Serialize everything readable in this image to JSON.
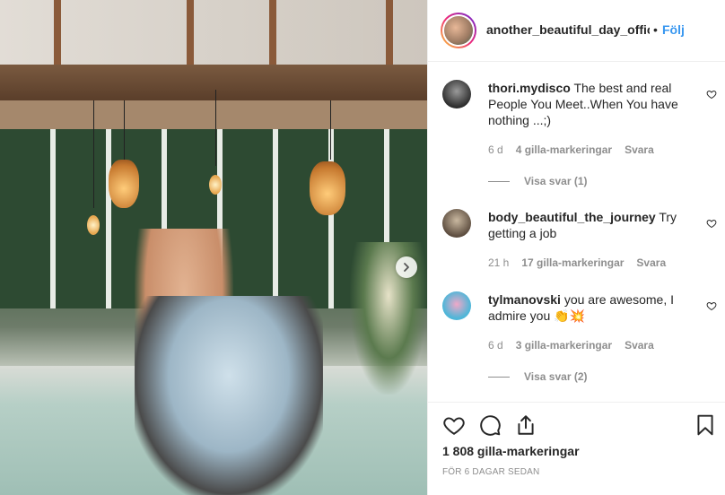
{
  "post": {
    "image_alt": "",
    "next_icon": "chevron-right-icon"
  },
  "header": {
    "username": "another_beautiful_day_offic",
    "separator": "•",
    "follow_label": "Följ"
  },
  "comments": [
    {
      "username": "thori.mydisco",
      "text": "The best and real People You Meet..When You have nothing ...;)",
      "time": "6 d",
      "likes": "4 gilla-markeringar",
      "reply_label": "Svara",
      "view_replies": "Visa svar (1)",
      "avatar_color": "#3a3a3a"
    },
    {
      "username": "body_beautiful_the_journey",
      "text": "Try getting a job",
      "time": "21 h",
      "likes": "17 gilla-markeringar",
      "reply_label": "Svara",
      "view_replies": "",
      "avatar_color": "#7a6a5a"
    },
    {
      "username": "tylmanovski",
      "text": "you are awesome, I admire you 👏💥",
      "time": "6 d",
      "likes": "3 gilla-markeringar",
      "reply_label": "Svara",
      "view_replies": "Visa svar (2)",
      "avatar_color": "#4fb6d8"
    }
  ],
  "actions": {
    "like_icon": "heart-icon",
    "comment_icon": "comment-icon",
    "share_icon": "share-icon",
    "save_icon": "bookmark-icon",
    "likes_count": "1 808 gilla-markeringar",
    "posted": "FÖR 6 DAGAR SEDAN"
  },
  "colors": {
    "link": "#3897f0",
    "muted": "#8e8e8e",
    "text": "#262626"
  }
}
